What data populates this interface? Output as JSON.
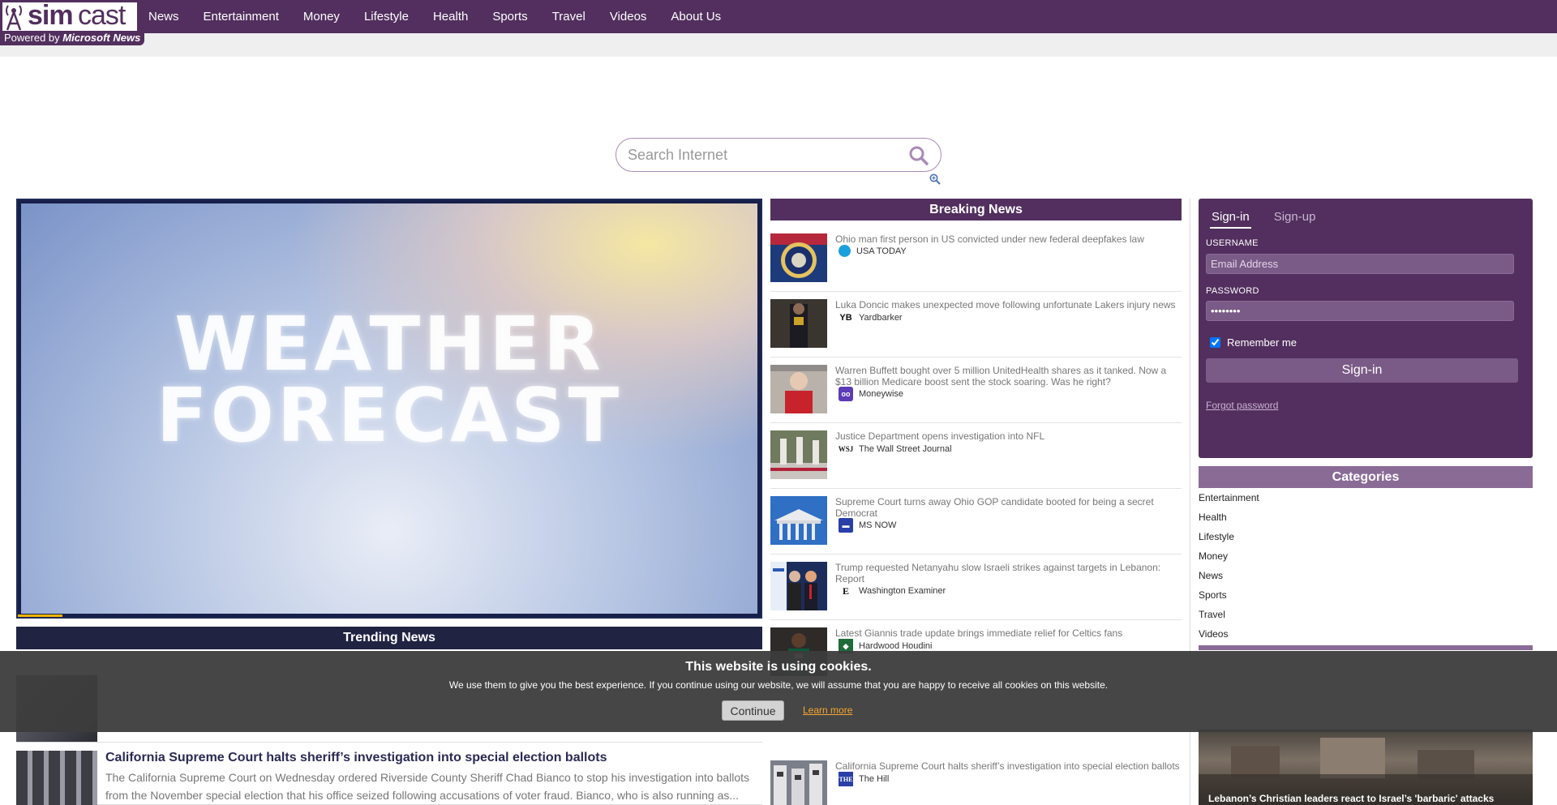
{
  "brand": {
    "logo_sim": "sim",
    "logo_cast": "cast",
    "powered_prefix": "Powered by ",
    "powered_name": "Microsoft News"
  },
  "nav": [
    "News",
    "Entertainment",
    "Money",
    "Lifestyle",
    "Health",
    "Sports",
    "Travel",
    "Videos",
    "About Us"
  ],
  "search": {
    "placeholder": "Search Internet"
  },
  "video": {
    "title_line1": "WEATHER",
    "title_line2": "FORECAST",
    "progress_fraction": 0.06
  },
  "trending": {
    "heading": "Trending News",
    "items": [
      {
        "title": "California Supreme Court halts sheriff’s investigation into special election ballots",
        "description": "The California Supreme Court on Wednesday ordered Riverside County Sheriff Chad Bianco to stop his investigation into ballots from the November special election that his office seized following accusations of voter fraud. Bianco, who is also running as..."
      }
    ]
  },
  "breaking": {
    "heading": "Breaking News",
    "items": [
      {
        "title": "Ohio man first person in US convicted under new federal deepfakes law",
        "source": "USA TODAY",
        "source_color": "#1aa0dc"
      },
      {
        "title": "Luka Doncic makes unexpected move following unfortunate Lakers injury news",
        "source": "Yardbarker",
        "source_color": "#111111"
      },
      {
        "title": "Warren Buffett bought over 5 million UnitedHealth shares as it tanked. Now a $13 billion Medicare boost sent the stock soaring. Was he right?",
        "source": "Moneywise",
        "source_color": "#5b3bb6"
      },
      {
        "title": "Justice Department opens investigation into NFL",
        "source": "The Wall Street Journal",
        "source_color": "#ffffff"
      },
      {
        "title": "Supreme Court turns away Ohio GOP candidate booted for being a secret Democrat",
        "source": "MS NOW",
        "source_color": "#2a3fa8"
      },
      {
        "title": "Trump requested Netanyahu slow Israeli strikes against targets in Lebanon: Report",
        "source": "Washington Examiner",
        "source_color": "#ffffff"
      },
      {
        "title": "Latest Giannis trade update brings immediate relief for Celtics fans",
        "source": "Hardwood Houdini",
        "source_color": "#1f6b3a"
      },
      {
        "title": "California Supreme Court halts sheriff’s investigation into special election ballots",
        "source": "The Hill",
        "source_color": "#2a3fa8"
      }
    ]
  },
  "signin": {
    "tab_signin": "Sign-in",
    "tab_signup": "Sign-up",
    "username_label": "USERNAME",
    "username_placeholder": "Email Address",
    "password_label": "PASSWORD",
    "password_value": "••••••••",
    "remember_label": "Remember me",
    "button_label": "Sign-in",
    "forgot_label": "Forgot password"
  },
  "categories": {
    "heading": "Categories",
    "items": [
      "Entertainment",
      "Health",
      "Lifestyle",
      "Money",
      "News",
      "Sports",
      "Travel",
      "Videos"
    ]
  },
  "right_card": {
    "title": "Lebanon’s Christian leaders react to Israel’s 'barbaric' attacks"
  },
  "cookie": {
    "title": "This website is using cookies.",
    "text": "We use them to give you the best experience. If you continue using our website, we will assume that you are happy to receive all cookies on this website.",
    "continue_label": "Continue",
    "learn_label": "Learn more"
  },
  "colors": {
    "brand": "#522f5e",
    "accent_light": "#8a6b96",
    "trending_bar": "#202342",
    "cookie_link": "#f6a531"
  }
}
